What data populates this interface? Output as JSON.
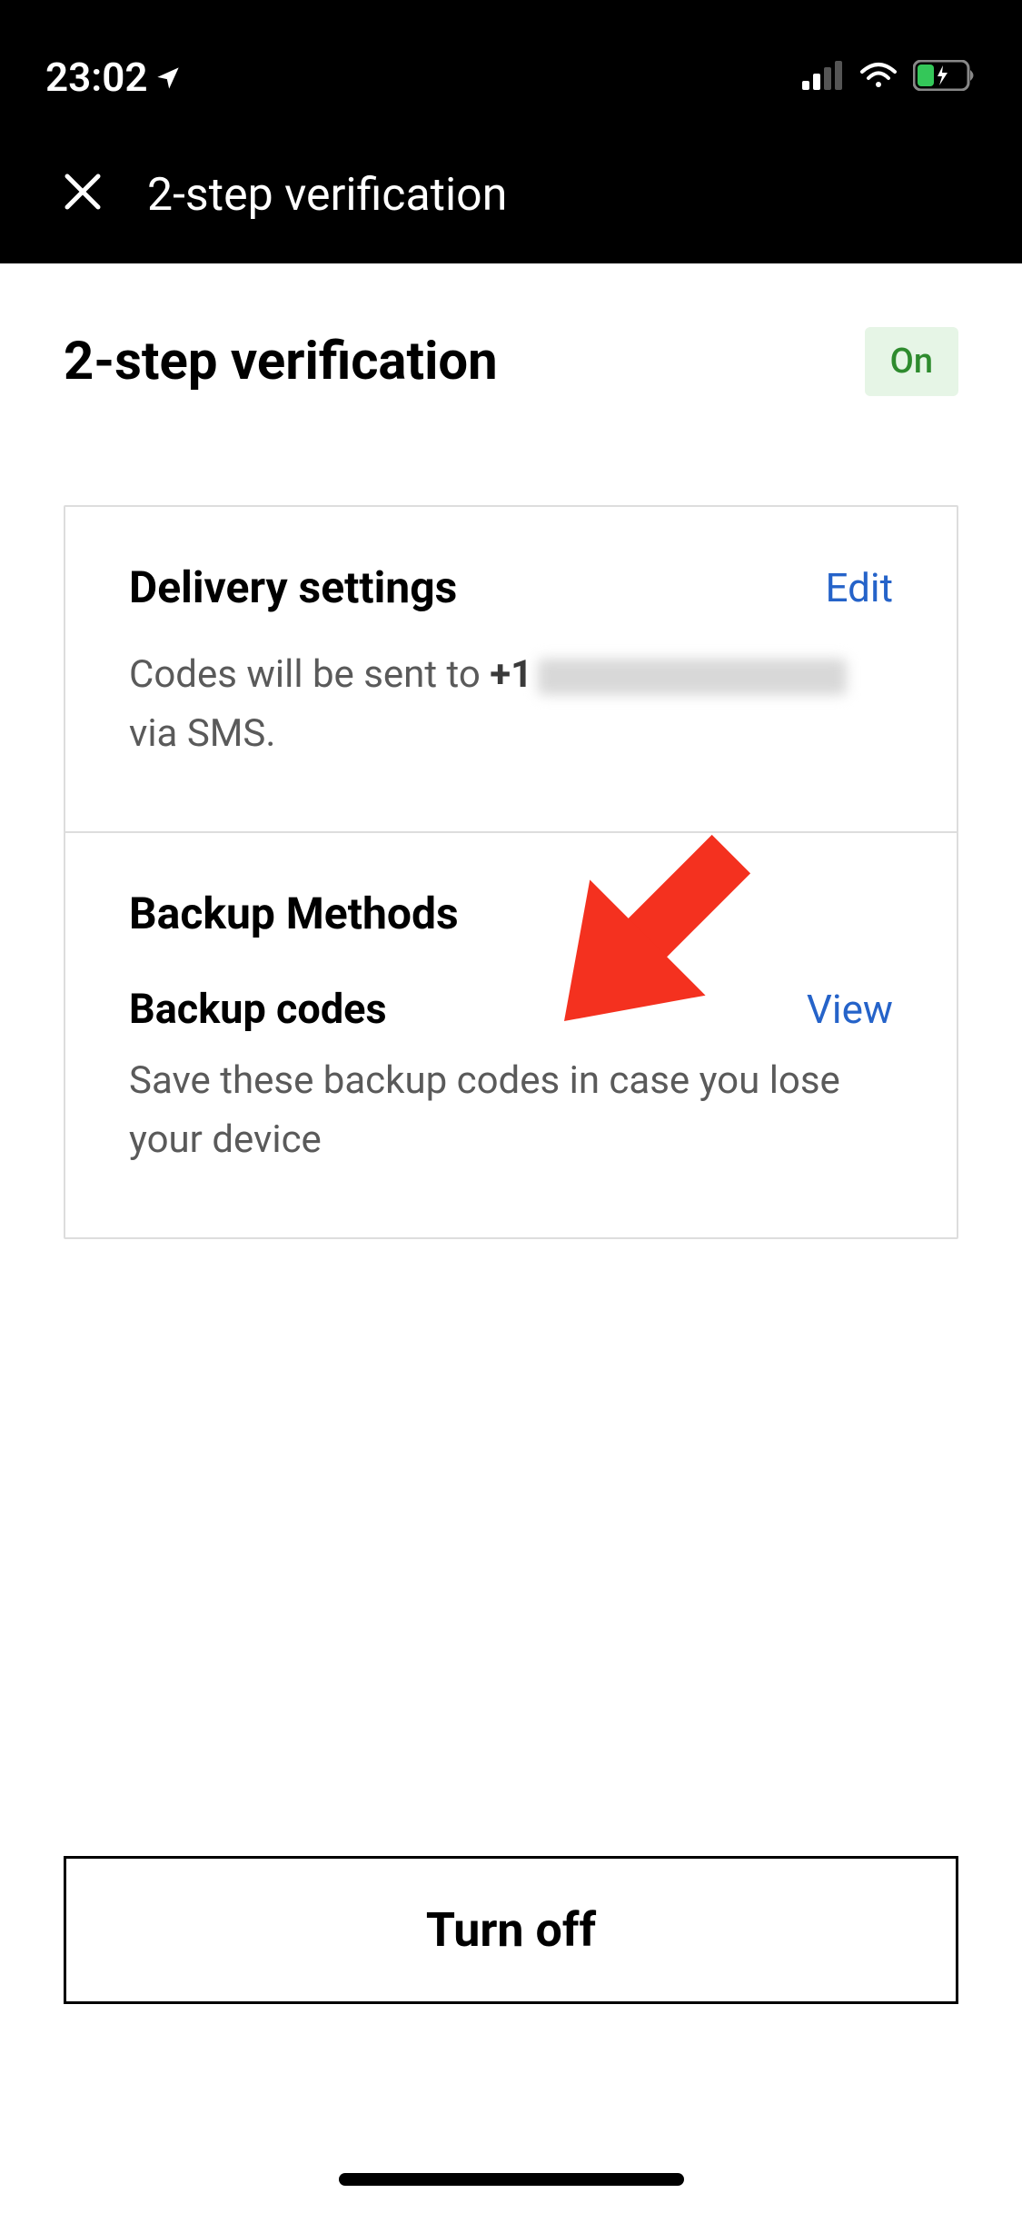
{
  "status_bar": {
    "time": "23:02"
  },
  "nav": {
    "title": "2-step verification"
  },
  "page": {
    "title": "2-step verification",
    "status_label": "On"
  },
  "delivery": {
    "title": "Delivery settings",
    "edit_label": "Edit",
    "body_prefix": "Codes will be sent to ",
    "phone_prefix": "+1",
    "body_suffix": " via SMS."
  },
  "backup": {
    "title": "Backup Methods",
    "sub_title": "Backup codes",
    "view_label": "View",
    "description": "Save these backup codes in case you lose your device"
  },
  "footer": {
    "turn_off_label": "Turn off"
  }
}
